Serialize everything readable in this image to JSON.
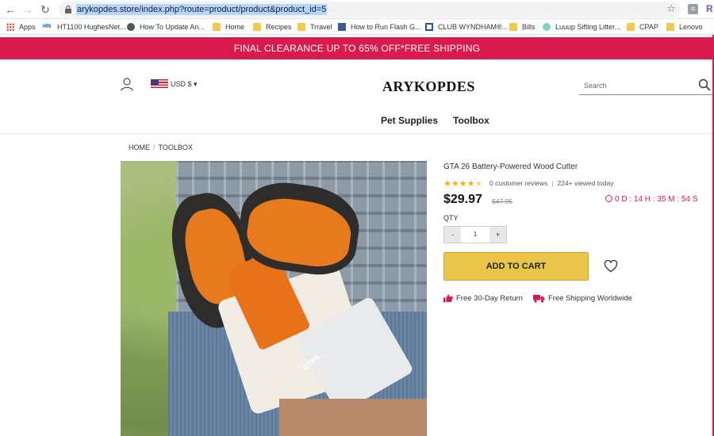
{
  "browser": {
    "url": "arykopdes.store/index.php?route=product/product&product_id=5",
    "ext_label": "R",
    "bookmarks": [
      "Apps",
      "HT1100 HughesNet...",
      "How To Update An...",
      "Home",
      "Recipes",
      "Trravel",
      "How to Run Flash G...",
      "CLUB WYNDHAM®...",
      "Bills",
      "Luuup Sifting Litter...",
      "CPAP",
      "Lenovo"
    ]
  },
  "promo": {
    "text": "FINAL CLEARANCE UP TO 65% OFF*FREE SHIPPING"
  },
  "header": {
    "currency": "USD $",
    "logo": "ARYKOPDES",
    "search_placeholder": "Search",
    "menu": [
      "Pet Supplies",
      "Toolbox"
    ]
  },
  "breadcrumb": [
    "HOME",
    "TOOLBOX"
  ],
  "product": {
    "title": "GTA 26 Battery-Powered Wood Cutter",
    "rating": 4.5,
    "reviews": "0 customer reviews",
    "viewed": "224+ viewed today",
    "price": "$29.97",
    "old_price": "$47.95",
    "countdown": "0 D : 14 H : 35 M : 54 S",
    "qty_label": "QTY",
    "qty_minus": "-",
    "qty_value": "1",
    "qty_plus": "+",
    "add_to_cart": "ADD TO CART",
    "feature_return": "Free 30-Day Return",
    "feature_shipping": "Free Shipping Worldwide",
    "image_brand_text": "STIHL"
  },
  "colors": {
    "accent": "#d91a4f",
    "cart_button": "#e9c54a",
    "star": "#f0ad1c"
  }
}
